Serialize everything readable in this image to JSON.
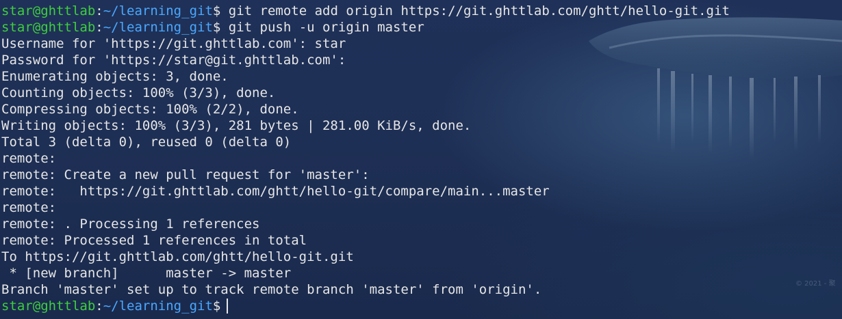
{
  "colors": {
    "background": "#1d2f54",
    "text": "#e6e6e6",
    "prompt_user": "#3ece3f",
    "prompt_path": "#4aa8ff"
  },
  "watermark": "© 2021 - 聚",
  "prompts": [
    {
      "user": "star@ghttlab",
      "sep": ":",
      "path": "~/learning_git",
      "sym": "$",
      "cmd": " git remote add origin https://git.ghttlab.com/ghtt/hello-git.git"
    },
    {
      "user": "star@ghttlab",
      "sep": ":",
      "path": "~/learning_git",
      "sym": "$",
      "cmd": " git push -u origin master"
    },
    {
      "user": "star@ghttlab",
      "sep": ":",
      "path": "~/learning_git",
      "sym": "$",
      "cmd": ""
    }
  ],
  "output": [
    "Username for 'https://git.ghttlab.com': star",
    "Password for 'https://star@git.ghttlab.com':",
    "Enumerating objects: 3, done.",
    "Counting objects: 100% (3/3), done.",
    "Compressing objects: 100% (2/2), done.",
    "Writing objects: 100% (3/3), 281 bytes | 281.00 KiB/s, done.",
    "Total 3 (delta 0), reused 0 (delta 0)",
    "remote:",
    "remote: Create a new pull request for 'master':",
    "remote:   https://git.ghttlab.com/ghtt/hello-git/compare/main...master",
    "remote:",
    "remote: . Processing 1 references",
    "remote: Processed 1 references in total",
    "To https://git.ghttlab.com/ghtt/hello-git.git",
    " * [new branch]      master -> master",
    "Branch 'master' set up to track remote branch 'master' from 'origin'."
  ]
}
